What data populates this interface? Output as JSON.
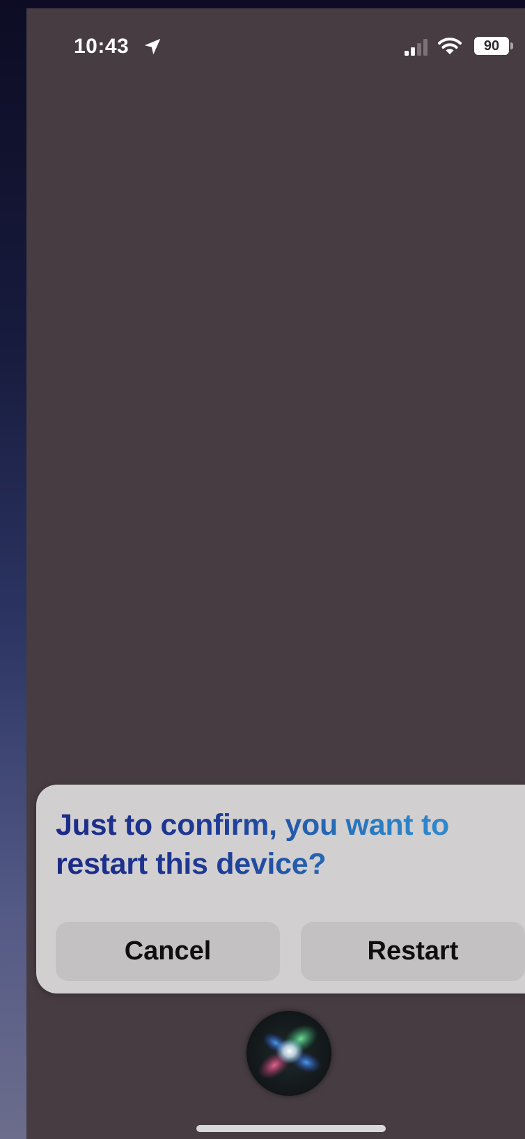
{
  "status_bar": {
    "time": "10:43",
    "battery_level": "90",
    "icons": [
      "location-arrow-icon",
      "cellular-signal-icon",
      "wifi-icon",
      "battery-icon"
    ]
  },
  "confirmation": {
    "question": "Just to confirm, you want to\nrestart this device?",
    "cancel_label": "Cancel",
    "restart_label": "Restart"
  },
  "siri": {
    "icon": "siri-orb-icon"
  },
  "colors": {
    "screen_background": "#463c42",
    "card_background": "#d2cfd0",
    "button_background": "#c4c1c3",
    "question_gradient_start": "#1c2a86",
    "question_gradient_end": "#3893d6"
  }
}
